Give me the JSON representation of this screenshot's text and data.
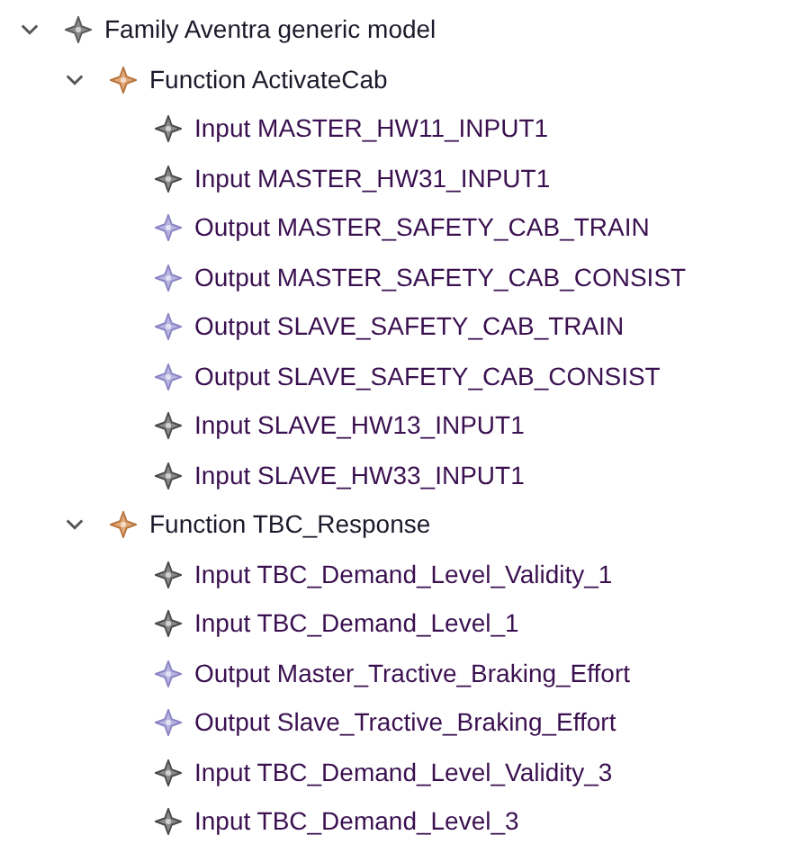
{
  "tree": [
    {
      "kind": "family",
      "label": "Family Aventra generic model",
      "expanded": true,
      "children": [
        {
          "kind": "function",
          "label": "Function ActivateCab",
          "expanded": true,
          "children": [
            {
              "kind": "input",
              "label": "Input MASTER_HW11_INPUT1"
            },
            {
              "kind": "input",
              "label": "Input MASTER_HW31_INPUT1"
            },
            {
              "kind": "output",
              "label": "Output MASTER_SAFETY_CAB_TRAIN"
            },
            {
              "kind": "output",
              "label": "Output MASTER_SAFETY_CAB_CONSIST"
            },
            {
              "kind": "output",
              "label": "Output SLAVE_SAFETY_CAB_TRAIN"
            },
            {
              "kind": "output",
              "label": "Output SLAVE_SAFETY_CAB_CONSIST"
            },
            {
              "kind": "input",
              "label": "Input SLAVE_HW13_INPUT1"
            },
            {
              "kind": "input",
              "label": "Input SLAVE_HW33_INPUT1"
            }
          ]
        },
        {
          "kind": "function",
          "label": "Function TBC_Response",
          "expanded": true,
          "children": [
            {
              "kind": "input",
              "label": "Input TBC_Demand_Level_Validity_1"
            },
            {
              "kind": "input",
              "label": "Input TBC_Demand_Level_1"
            },
            {
              "kind": "output",
              "label": "Output Master_Tractive_Braking_Effort"
            },
            {
              "kind": "output",
              "label": "Output Slave_Tractive_Braking_Effort"
            },
            {
              "kind": "input",
              "label": "Input TBC_Demand_Level_Validity_3"
            },
            {
              "kind": "input",
              "label": "Input TBC_Demand_Level_3"
            }
          ]
        }
      ]
    }
  ]
}
